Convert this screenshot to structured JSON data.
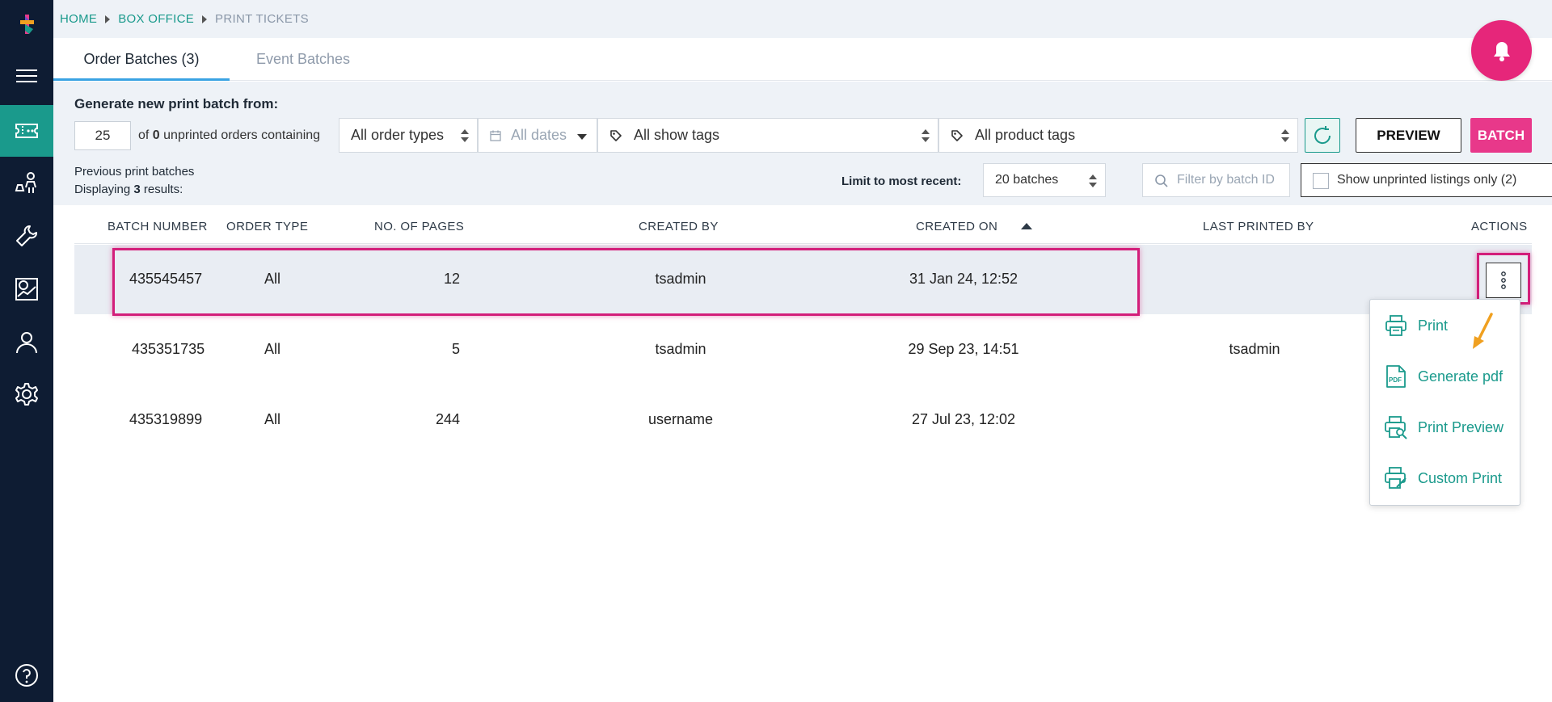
{
  "sidebar": {
    "items": [
      {
        "icon": "logo-icon"
      },
      {
        "icon": "hamburger-menu-icon"
      },
      {
        "icon": "ticket-icon",
        "active": true
      },
      {
        "icon": "people-icon"
      },
      {
        "icon": "wrench-icon"
      },
      {
        "icon": "reports-icon"
      },
      {
        "icon": "user-icon"
      },
      {
        "icon": "gear-icon"
      },
      {
        "icon": "help-icon"
      }
    ]
  },
  "breadcrumb": {
    "home": "HOME",
    "box_office": "BOX OFFICE",
    "current": "PRINT TICKETS"
  },
  "tabs": {
    "order_batches": "Order Batches (3)",
    "event_batches": "Event Batches"
  },
  "generate": {
    "title": "Generate new print batch from:",
    "quantity": "25",
    "of_prefix": "of ",
    "unprinted_count": "0",
    "of_suffix": " unprinted orders containing",
    "order_types": "All order types",
    "dates_placeholder": "All dates",
    "show_tags": "All show tags",
    "product_tags": "All product tags",
    "preview_label": "PREVIEW",
    "batch_label": "BATCH"
  },
  "previous": {
    "title": "Previous print batches",
    "displaying_prefix": "Displaying ",
    "displaying_count": "3",
    "displaying_suffix": " results:",
    "limit_label": "Limit to most recent:",
    "limit_value": "20 batches",
    "filter_placeholder": "Filter by batch ID",
    "unprinted_label": "Show unprinted listings only (2)"
  },
  "table": {
    "headers": {
      "batch_number": "BATCH NUMBER",
      "order_type": "ORDER TYPE",
      "pages": "NO. OF PAGES",
      "created_by": "CREATED BY",
      "created_on": "CREATED ON",
      "last_printed_by": "LAST PRINTED BY",
      "actions": "ACTIONS"
    },
    "rows": [
      {
        "batch_number": "435545457",
        "order_type": "All",
        "pages": "12",
        "created_by": "tsadmin",
        "created_on": "31 Jan 24, 12:52",
        "last_printed_by": ""
      },
      {
        "batch_number": "435351735",
        "order_type": "All",
        "pages": "5",
        "created_by": "tsadmin",
        "created_on": "29 Sep 23, 14:51",
        "last_printed_by": "tsadmin"
      },
      {
        "batch_number": "435319899",
        "order_type": "All",
        "pages": "244",
        "created_by": "username",
        "created_on": "27 Jul 23, 12:02",
        "last_printed_by": ""
      }
    ]
  },
  "actions_menu": {
    "print": "Print",
    "generate_pdf": "Generate pdf",
    "print_preview": "Print Preview",
    "custom_print": "Custom Print"
  },
  "colors": {
    "sidebar": "#0e1c33",
    "accent_teal": "#1a9a8c",
    "accent_pink": "#e8388a",
    "highlight": "#d31e7a",
    "arrow": "#f0a020"
  }
}
